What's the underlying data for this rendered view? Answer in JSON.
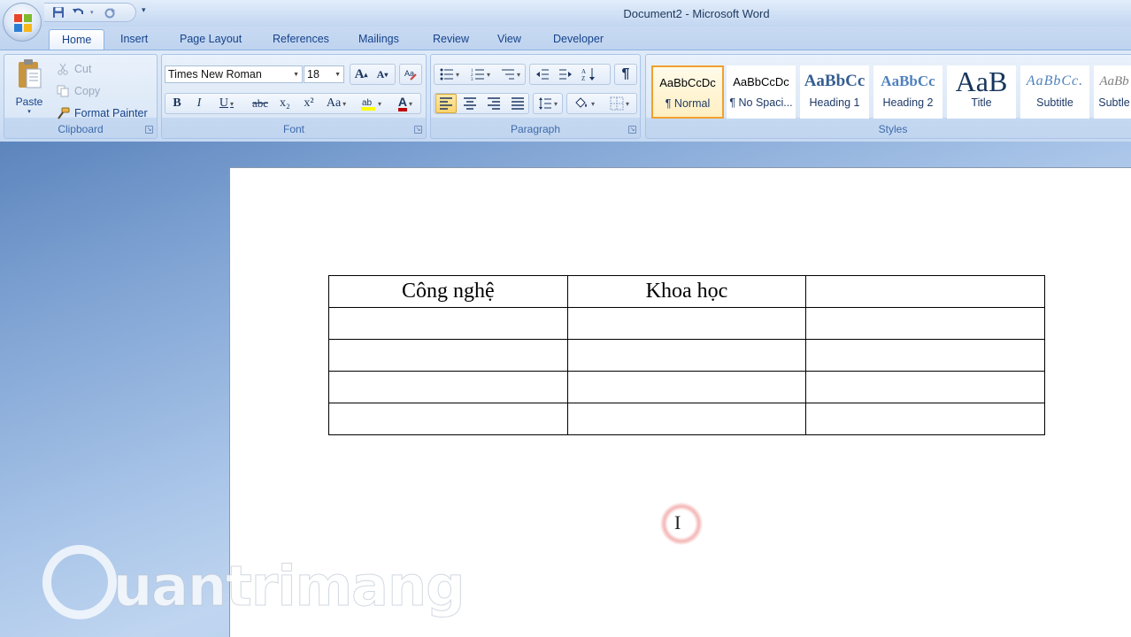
{
  "window": {
    "title": "Document2 - Microsoft Word"
  },
  "quick_access": {
    "icons": [
      "save-icon",
      "undo-icon",
      "redo-icon",
      "customize-icon"
    ]
  },
  "tabs": [
    {
      "label": "Home",
      "active": true
    },
    {
      "label": "Insert"
    },
    {
      "label": "Page Layout"
    },
    {
      "label": "References"
    },
    {
      "label": "Mailings"
    },
    {
      "label": "Review"
    },
    {
      "label": "View"
    },
    {
      "label": "Developer"
    }
  ],
  "clipboard": {
    "group_label": "Clipboard",
    "paste": "Paste",
    "cut": "Cut",
    "copy": "Copy",
    "format_painter": "Format Painter"
  },
  "font": {
    "group_label": "Font",
    "family": "Times New Roman",
    "size": "18",
    "bold": "B",
    "italic": "I",
    "underline": "U",
    "strikethrough": "abc",
    "subscript": "x₂",
    "superscript": "x²",
    "change_case": "Aa",
    "grow": "A",
    "shrink": "A",
    "font_color": "A",
    "highlight_color": "#ffff00",
    "font_color_value": "#c00000"
  },
  "paragraph": {
    "group_label": "Paragraph",
    "show_marks": "¶"
  },
  "styles": {
    "group_label": "Styles",
    "items": [
      {
        "sample": "AaBbCcDc",
        "name": "¶ Normal",
        "active": true
      },
      {
        "sample": "AaBbCcDc",
        "name": "¶ No Spaci..."
      },
      {
        "sample": "AaBbCc",
        "name": "Heading 1"
      },
      {
        "sample": "AaBbCc",
        "name": "Heading 2"
      },
      {
        "sample": "AaB",
        "name": "Title"
      },
      {
        "sample": "AaBbCc.",
        "name": "Subtitle"
      },
      {
        "sample": "AaBb",
        "name": "Subtle"
      }
    ]
  },
  "document": {
    "table": [
      [
        "Công nghệ",
        "Khoa học",
        ""
      ],
      [
        "",
        "",
        ""
      ],
      [
        "",
        "",
        ""
      ],
      [
        "",
        "",
        ""
      ],
      [
        "",
        "",
        ""
      ]
    ]
  },
  "watermark": {
    "text": "uantrimang"
  },
  "colors": {
    "ribbon_text": "#15428b",
    "active_style_border": "#f0a030",
    "doc_background": "#7fa3d3"
  }
}
